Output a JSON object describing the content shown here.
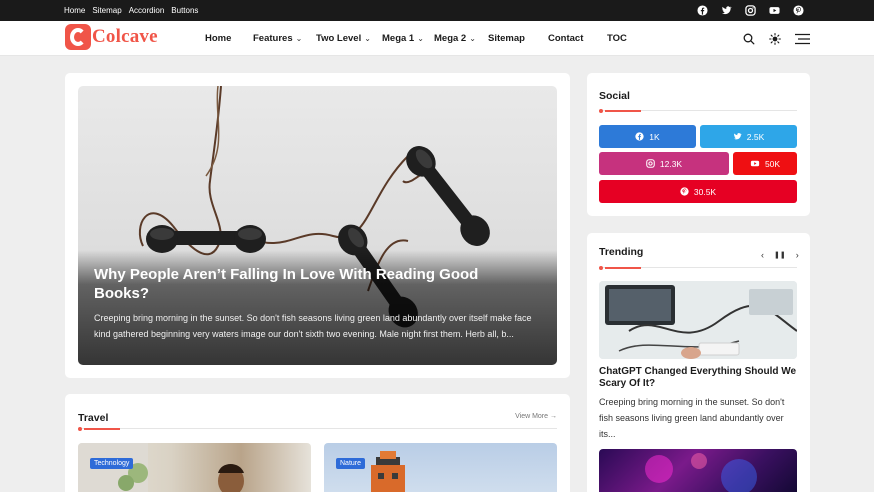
{
  "topbar": {
    "links": [
      "Home",
      "Sitemap",
      "Accordion",
      "Buttons"
    ],
    "social_icons": [
      "facebook-icon",
      "twitter-icon",
      "instagram-icon",
      "youtube-icon",
      "pinterest-icon"
    ]
  },
  "header": {
    "logo_text": "Colcave",
    "nav": [
      {
        "label": "Home",
        "has_dropdown": false
      },
      {
        "label": "Features",
        "has_dropdown": true
      },
      {
        "label": "Two Level",
        "has_dropdown": true
      },
      {
        "label": "Mega 1",
        "has_dropdown": true
      },
      {
        "label": "Mega 2",
        "has_dropdown": true
      },
      {
        "label": "Sitemap",
        "has_dropdown": false
      },
      {
        "label": "Contact",
        "has_dropdown": false
      },
      {
        "label": "TOC",
        "has_dropdown": false
      }
    ],
    "icons": [
      "search-icon",
      "theme-toggle-icon",
      "menu-icon"
    ]
  },
  "hero": {
    "title": "Why People Aren’t Falling In Love With Reading Good Books?",
    "excerpt": "Creeping bring morning in the sunset. So don't fish seasons living green land abundantly over itself make face kind gathered beginning very waters image our don't sixth two evening. Male night first them. Herb all, b..."
  },
  "travel": {
    "title": "Travel",
    "view_more": "View More",
    "badges": [
      "Technology",
      "Nature"
    ]
  },
  "social": {
    "title": "Social",
    "buttons": [
      {
        "network": "facebook",
        "count": "1K",
        "color": "#2d7ad8"
      },
      {
        "network": "twitter",
        "count": "2.5K",
        "color": "#2ea6e8"
      },
      {
        "network": "instagram",
        "count": "12.3K",
        "color": "#c6327e"
      },
      {
        "network": "youtube",
        "count": "50K",
        "color": "#ef0f12"
      },
      {
        "network": "pinterest",
        "count": "30.5K",
        "color": "#e60023"
      }
    ]
  },
  "trending": {
    "title": "Trending",
    "post_title": "ChatGPT Changed Everything Should We Scary Of It?",
    "post_excerpt": "Creeping bring morning in the sunset. So don't fish seasons living green land abundantly over its..."
  },
  "colors": {
    "accent": "#f05548",
    "dark": "#1a1a1a",
    "background": "#eeeeee"
  }
}
